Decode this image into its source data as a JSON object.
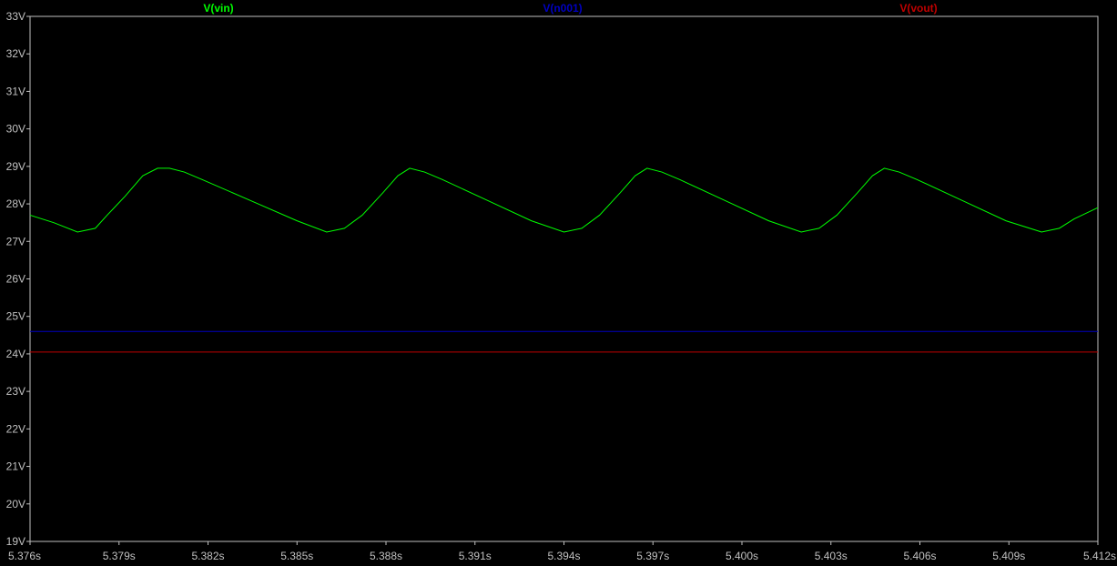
{
  "chart_data": {
    "type": "line",
    "xlim": [
      5.376,
      5.412
    ],
    "ylim": [
      19,
      33
    ],
    "x_ticks": [
      "5.376s",
      "5.379s",
      "5.382s",
      "5.385s",
      "5.388s",
      "5.391s",
      "5.394s",
      "5.397s",
      "5.400s",
      "5.403s",
      "5.406s",
      "5.409s",
      "5.412s"
    ],
    "x_tick_values": [
      5.376,
      5.379,
      5.382,
      5.385,
      5.388,
      5.391,
      5.394,
      5.397,
      5.4,
      5.403,
      5.406,
      5.409,
      5.412
    ],
    "y_ticks": [
      "19V",
      "20V",
      "21V",
      "22V",
      "23V",
      "24V",
      "25V",
      "26V",
      "27V",
      "28V",
      "29V",
      "30V",
      "31V",
      "32V",
      "33V"
    ],
    "y_tick_values": [
      19,
      20,
      21,
      22,
      23,
      24,
      25,
      26,
      27,
      28,
      29,
      30,
      31,
      32,
      33
    ],
    "grid": false,
    "legend_placement": "top",
    "series": [
      {
        "name": "V(vin)",
        "color": "#00ff00",
        "x": [
          5.376,
          5.3768,
          5.3776,
          5.3782,
          5.3786,
          5.3792,
          5.3798,
          5.3803,
          5.3807,
          5.3812,
          5.3818,
          5.3834,
          5.385,
          5.386,
          5.3866,
          5.3872,
          5.3879,
          5.3884,
          5.3888,
          5.3893,
          5.3899,
          5.3914,
          5.3929,
          5.394,
          5.3946,
          5.3952,
          5.3959,
          5.3964,
          5.3968,
          5.3973,
          5.3979,
          5.3994,
          5.4009,
          5.402,
          5.4026,
          5.4032,
          5.4039,
          5.4044,
          5.4048,
          5.4053,
          5.4059,
          5.4074,
          5.4089,
          5.4101,
          5.4107,
          5.4112,
          5.412
        ],
        "y": [
          27.7,
          27.5,
          27.25,
          27.35,
          27.7,
          28.2,
          28.75,
          28.95,
          28.95,
          28.85,
          28.65,
          28.1,
          27.55,
          27.25,
          27.35,
          27.7,
          28.3,
          28.75,
          28.95,
          28.85,
          28.65,
          28.1,
          27.55,
          27.25,
          27.35,
          27.7,
          28.3,
          28.75,
          28.95,
          28.85,
          28.65,
          28.1,
          27.55,
          27.25,
          27.35,
          27.7,
          28.3,
          28.75,
          28.95,
          28.85,
          28.65,
          28.1,
          27.55,
          27.25,
          27.35,
          27.6,
          27.9
        ]
      },
      {
        "name": "V(n001)",
        "color": "#0000c0",
        "x": [
          5.376,
          5.412
        ],
        "y": [
          24.6,
          24.6
        ]
      },
      {
        "name": "V(vout)",
        "color": "#c00000",
        "x": [
          5.376,
          5.412
        ],
        "y": [
          24.05,
          24.05
        ]
      }
    ]
  }
}
